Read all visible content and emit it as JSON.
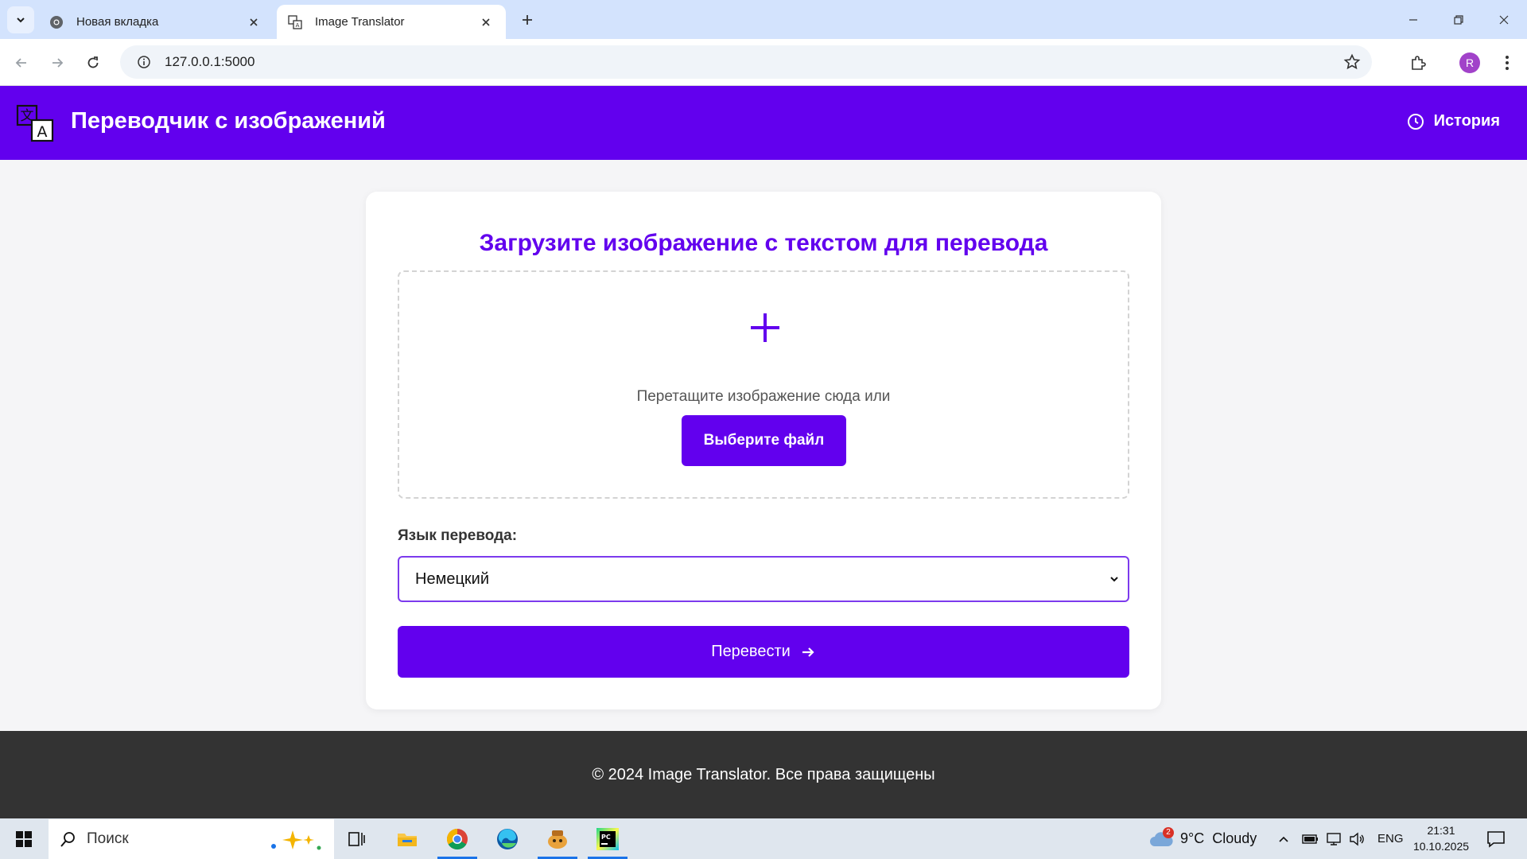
{
  "browser": {
    "tabs": [
      {
        "title": "Новая вкладка",
        "active": false
      },
      {
        "title": "Image Translator",
        "active": true
      }
    ],
    "url": "127.0.0.1:5000",
    "profile_initial": "R"
  },
  "app": {
    "title": "Переводчик с изображений",
    "history_label": "История",
    "heading": "Загрузите изображение с текстом для перевода",
    "drop_text": "Перетащите изображение сюда или",
    "choose_file_label": "Выберите файл",
    "language_label": "Язык перевода:",
    "selected_language": "Немецкий",
    "translate_label": "Перевести",
    "footer_text": "© 2024 Image Translator. Все права защищены"
  },
  "taskbar": {
    "search_placeholder": "Поиск",
    "weather_badge": "2",
    "weather_text": "9°C  Cloudy",
    "language": "ENG",
    "time": "21:31",
    "date": "10.10.2025"
  },
  "colors": {
    "accent": "#6200ee",
    "footer": "#333333",
    "tabbar": "#d3e3fd"
  }
}
